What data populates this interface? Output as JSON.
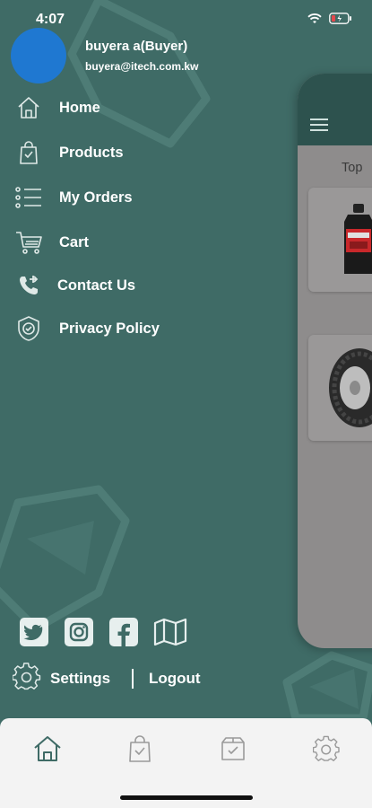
{
  "status_bar": {
    "time": "4:07"
  },
  "profile": {
    "name": "buyera a(Buyer)",
    "email": "buyera@itech.com.kw"
  },
  "menu": {
    "items": [
      {
        "label": "Home",
        "icon": "home-icon"
      },
      {
        "label": "Products",
        "icon": "shopping-bag-icon"
      },
      {
        "label": "My Orders",
        "icon": "list-icon"
      },
      {
        "label": "Cart",
        "icon": "cart-icon"
      },
      {
        "label": "Contact Us",
        "icon": "phone-icon"
      },
      {
        "label": "Privacy Policy",
        "icon": "shield-icon"
      }
    ]
  },
  "preview": {
    "section_title": "Top"
  },
  "social": [
    "twitter-icon",
    "instagram-icon",
    "facebook-icon",
    "map-icon"
  ],
  "footer": {
    "settings_label": "Settings",
    "logout_label": "Logout"
  },
  "tabbar": {
    "tabs": [
      "home-icon",
      "shopping-bag-icon",
      "orders-box-icon",
      "settings-icon"
    ]
  },
  "colors": {
    "drawer_bg": "#3f6b66",
    "avatar": "#1f78d1",
    "accent": "#2d524e",
    "tabbar_bg": "#f3f3f3"
  }
}
